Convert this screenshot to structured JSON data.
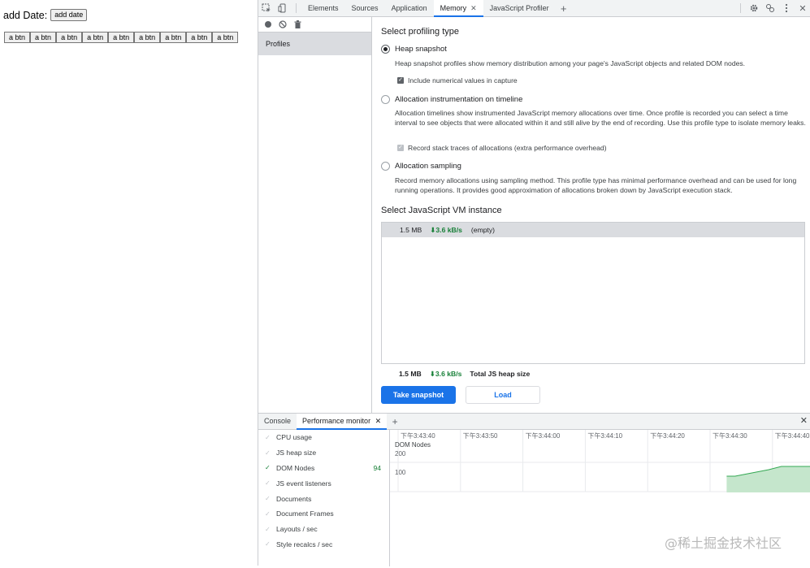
{
  "page": {
    "add_date_label": "add Date:",
    "add_date_button": "add date",
    "btn_labels": [
      "a btn",
      "a btn",
      "a btn",
      "a btn",
      "a btn",
      "a btn",
      "a btn",
      "a btn",
      "a btn"
    ]
  },
  "devtools": {
    "tabs": [
      {
        "label": "Elements",
        "active": false
      },
      {
        "label": "Sources",
        "active": false
      },
      {
        "label": "Application",
        "active": false
      },
      {
        "label": "Memory",
        "active": true
      },
      {
        "label": "JavaScript Profiler",
        "active": false
      }
    ],
    "sidebar": {
      "profiles_label": "Profiles"
    },
    "memory": {
      "select_type_title": "Select profiling type",
      "options": [
        {
          "label": "Heap snapshot",
          "checked": true,
          "description": "Heap snapshot profiles show memory distribution among your page's JavaScript objects and related DOM nodes.",
          "checkbox": "Include numerical values in capture"
        },
        {
          "label": "Allocation instrumentation on timeline",
          "checked": false,
          "description": "Allocation timelines show instrumented JavaScript memory allocations over time. Once profile is recorded you can select a time interval to see objects that were allocated within it and still alive by the end of recording. Use this profile type to isolate memory leaks.",
          "checkbox": "Record stack traces of allocations (extra performance overhead)"
        },
        {
          "label": "Allocation sampling",
          "checked": false,
          "description": "Record memory allocations using sampling method. This profile type has minimal performance overhead and can be used for long running operations. It provides good approximation of allocations broken down by JavaScript execution stack."
        }
      ],
      "vm_title": "Select JavaScript VM instance",
      "vm_row": {
        "size": "1.5 MB",
        "rate": "⬇3.6 kB/s",
        "name": "(empty)"
      },
      "summary": {
        "size": "1.5 MB",
        "rate": "⬇3.6 kB/s",
        "label": "Total JS heap size"
      },
      "take_snapshot": "Take snapshot",
      "load": "Load"
    },
    "drawer": {
      "tabs": [
        {
          "label": "Console",
          "active": false
        },
        {
          "label": "Performance monitor",
          "active": true
        }
      ],
      "metrics": [
        {
          "label": "CPU usage",
          "enabled": false,
          "value": ""
        },
        {
          "label": "JS heap size",
          "enabled": false,
          "value": ""
        },
        {
          "label": "DOM Nodes",
          "enabled": true,
          "value": "94"
        },
        {
          "label": "JS event listeners",
          "enabled": false,
          "value": ""
        },
        {
          "label": "Documents",
          "enabled": false,
          "value": ""
        },
        {
          "label": "Document Frames",
          "enabled": false,
          "value": ""
        },
        {
          "label": "Layouts / sec",
          "enabled": false,
          "value": ""
        },
        {
          "label": "Style recalcs / sec",
          "enabled": false,
          "value": ""
        }
      ],
      "graph": {
        "time_labels": [
          "下午3:43:40",
          "下午3:43:50",
          "下午3:44:00",
          "下午3:44:10",
          "下午3:44:20",
          "下午3:44:30",
          "下午3:44:40"
        ],
        "series_label": "DOM Nodes",
        "y_ticks": [
          "200",
          "100"
        ],
        "series_color": "#34a853",
        "fill_color": "#c5e6cc",
        "points": [
          [
            0.8,
            68
          ],
          [
            0.82,
            68
          ],
          [
            0.86,
            72
          ],
          [
            0.9,
            76
          ],
          [
            0.93,
            80
          ],
          [
            1.0,
            80
          ]
        ]
      }
    }
  },
  "watermark": "@稀土掘金技术社区"
}
